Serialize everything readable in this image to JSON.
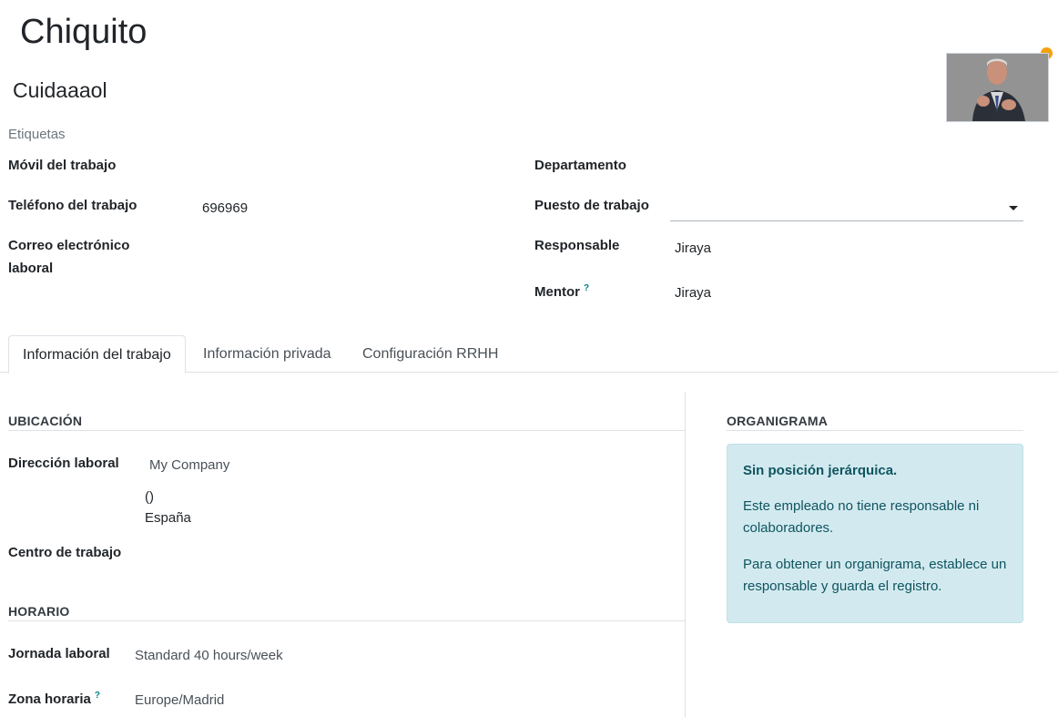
{
  "employee": {
    "name": "Chiquito",
    "job_title": "Cuidaaaol",
    "tags_placeholder": "Etiquetas"
  },
  "fields_left": {
    "work_mobile_label": "Móvil del trabajo",
    "work_phone_label": "Teléfono del trabajo",
    "work_phone_value": "696969",
    "work_email_label_1": "Correo electrónico",
    "work_email_label_2": "laboral"
  },
  "fields_right": {
    "department_label": "Departamento",
    "job_position_label": "Puesto de trabajo",
    "manager_label": "Responsable",
    "manager_value": "Jiraya",
    "mentor_label": "Mentor",
    "mentor_help": "?",
    "mentor_value": "Jiraya"
  },
  "tabs": [
    {
      "label": "Información del trabajo",
      "active": true
    },
    {
      "label": "Información privada",
      "active": false
    },
    {
      "label": "Configuración RRHH",
      "active": false
    }
  ],
  "location": {
    "section_title": "UBICACIÓN",
    "work_address_label": "Dirección laboral",
    "work_address_value": "My Company",
    "address_line_1": "()",
    "address_line_2": "España",
    "work_location_label": "Centro de trabajo"
  },
  "schedule": {
    "section_title": "HORARIO",
    "working_hours_label": "Jornada laboral",
    "working_hours_value": "Standard 40 hours/week",
    "timezone_label": "Zona horaria",
    "timezone_help": "?",
    "timezone_value": "Europe/Madrid"
  },
  "org_chart": {
    "section_title": "ORGANIGRAMA",
    "alert_title": "Sin posición jerárquica.",
    "alert_text_1": "Este empleado no tiene responsable ni colaboradores.",
    "alert_text_2": "Para obtener un organigrama, establece un responsable y guarda el registro."
  },
  "colors": {
    "status_dot": "#f3a10c",
    "alert_bg": "#d2eaef",
    "alert_text": "#0f5460",
    "help_mark": "#017e84"
  }
}
